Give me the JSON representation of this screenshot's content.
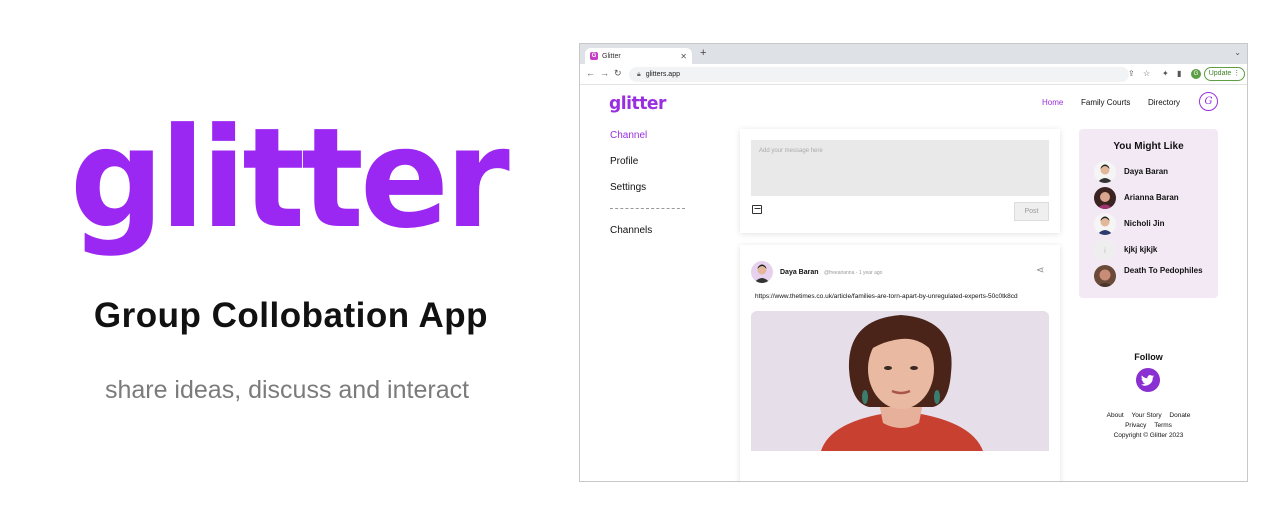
{
  "promo": {
    "logo_text": "glitter",
    "title": "Group Collobation App",
    "subtitle": "share ideas, discuss and interact"
  },
  "browser": {
    "tab_title": "Glitter",
    "favicon_letter": "G",
    "url": "glitters.app",
    "profile_letter": "G",
    "update_label": "Update"
  },
  "site": {
    "logo_text": "glitter",
    "nav": [
      "Home",
      "Family Courts",
      "Directory"
    ],
    "user_badge": "G",
    "sidebar": [
      "Channel",
      "Profile",
      "Settings",
      "Channels"
    ],
    "composer": {
      "placeholder": "Add your message here",
      "post_label": "Post"
    },
    "post": {
      "author": "Daya Baran",
      "meta": "@freearianna - 1 year ago",
      "link": "https://www.thetimes.co.uk/article/families-are-torn-apart-by-unregulated-experts-50c0tk8cd"
    },
    "suggestions": {
      "title": "You Might Like",
      "people": [
        "Daya Baran",
        "Arianna Baran",
        "Nicholi Jin",
        "kjkj kjkjk",
        "Death To Pedophiles"
      ]
    },
    "follow_label": "Follow",
    "footer": {
      "links_row1": [
        "About",
        "Your Story",
        "Donate"
      ],
      "links_row2": [
        "Privacy",
        "Terms"
      ],
      "copyright": "Copyright © Glitter 2023"
    }
  },
  "colors": {
    "brand": "#9a2fe0",
    "suggest_bg": "#f3e9f5"
  }
}
